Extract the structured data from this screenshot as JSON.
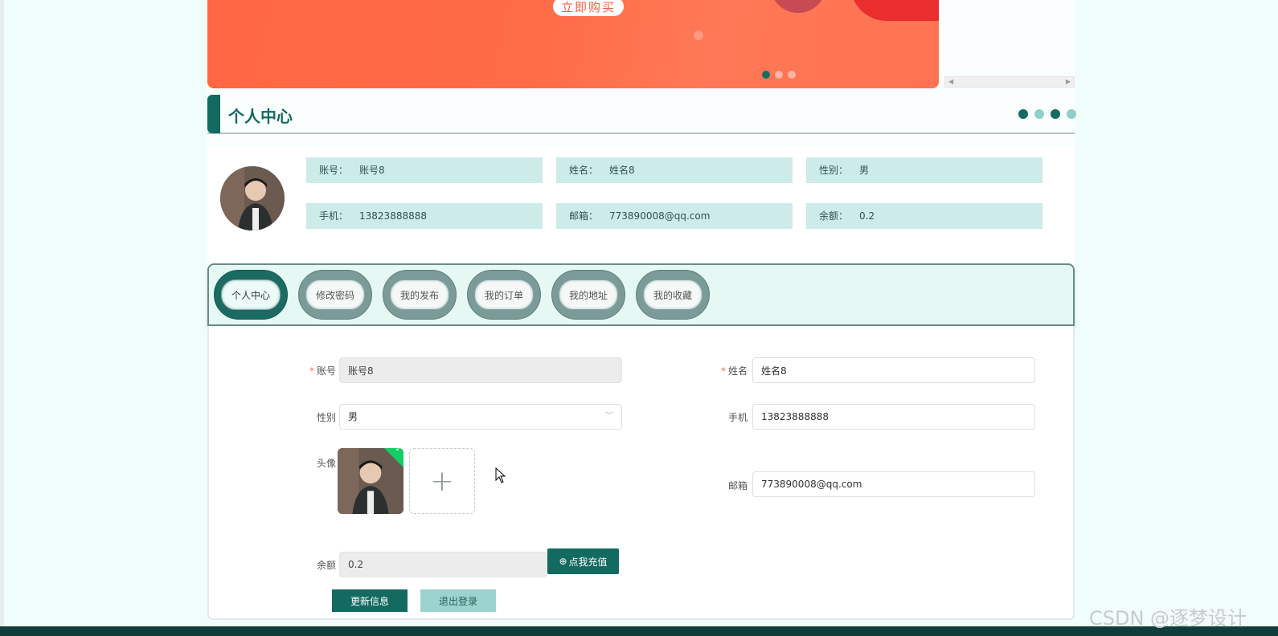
{
  "banner": {
    "buy_button": "立即购买",
    "slide_count": 3,
    "active_slide": 1
  },
  "section": {
    "title": "个人中心"
  },
  "profile": {
    "account_label": "账号：",
    "account_value": "账号8",
    "name_label": "姓名：",
    "name_value": "姓名8",
    "gender_label": "性别：",
    "gender_value": "男",
    "phone_label": "手机：",
    "phone_value": "13823888888",
    "email_label": "邮箱：",
    "email_value": "773890008@qq.com",
    "balance_label": "余额：",
    "balance_value": "0.2"
  },
  "tabs": [
    {
      "label": "个人中心",
      "active": true
    },
    {
      "label": "修改密码",
      "active": false
    },
    {
      "label": "我的发布",
      "active": false
    },
    {
      "label": "我的订单",
      "active": false
    },
    {
      "label": "我的地址",
      "active": false
    },
    {
      "label": "我的收藏",
      "active": false
    }
  ],
  "form": {
    "account_label": "账号",
    "account_value": "账号8",
    "name_label": "姓名",
    "name_value": "姓名8",
    "gender_label": "性别",
    "gender_value": "男",
    "phone_label": "手机",
    "phone_value": "13823888888",
    "avatar_label": "头像",
    "email_label": "邮箱",
    "email_value": "773890008@qq.com",
    "balance_label": "余额",
    "balance_value": "0.2",
    "recharge_button": "点我充值",
    "update_button": "更新信息",
    "logout_button": "退出登录"
  },
  "watermark": "CSDN @逐梦设计",
  "colors": {
    "primary": "#136a60",
    "light_teal": "#cdebe8",
    "banner_orange": "#ff6842"
  },
  "icons": {
    "upload": "plus-icon",
    "recharge": "circle-plus-icon",
    "uploaded": "check-icon"
  }
}
